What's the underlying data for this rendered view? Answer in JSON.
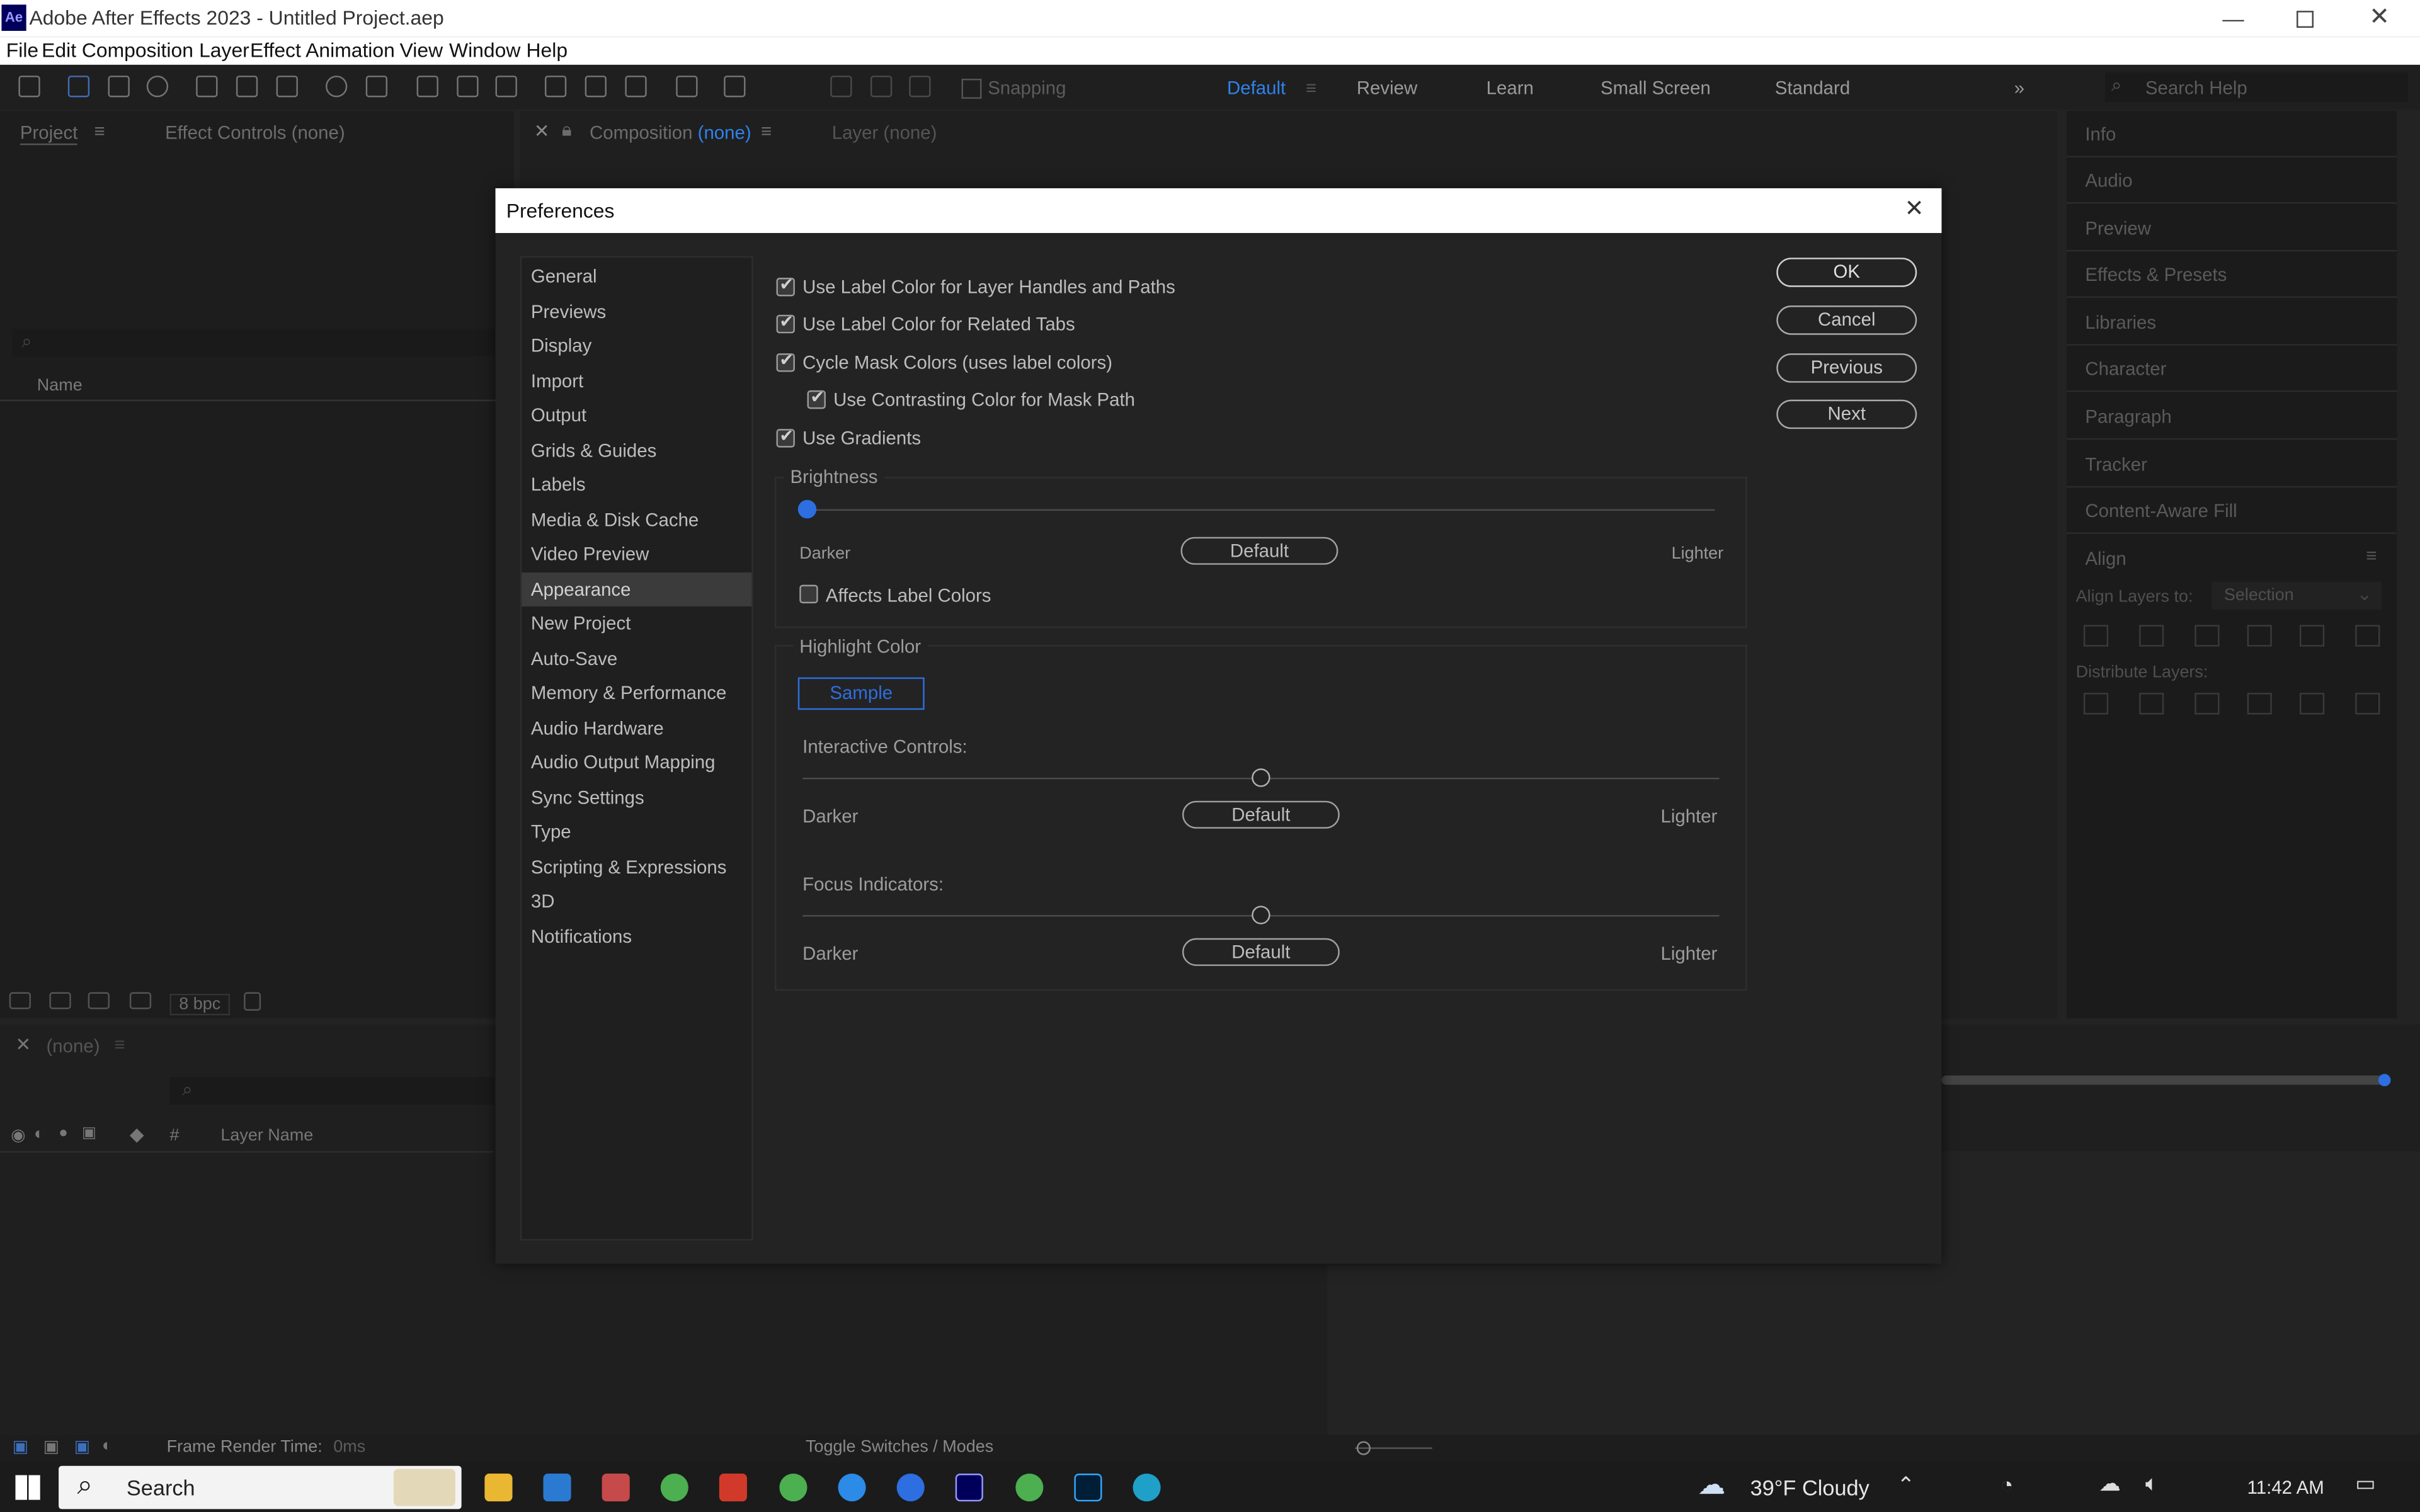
{
  "window": {
    "app_icon": "Ae",
    "title": "Adobe After Effects 2023 - Untitled Project.aep",
    "controls": [
      "minimize-icon",
      "restore-icon",
      "close-icon"
    ]
  },
  "menu": [
    "File",
    "Edit",
    "Composition",
    "Layer",
    "Effect",
    "Animation",
    "View",
    "Window",
    "Help"
  ],
  "toolbar": {
    "snapping_label": "Snapping",
    "workspaces": [
      "Default",
      "Review",
      "Learn",
      "Small Screen",
      "Standard"
    ],
    "active_workspace": "Default",
    "search_placeholder": "Search Help"
  },
  "project_panel": {
    "tab_project": "Project",
    "tab_effect_controls": "Effect Controls (none)",
    "column_name": "Name",
    "bpc": "8 bpc"
  },
  "comp_panel": {
    "tab_composition": "Composition",
    "tab_composition_value": "(none)",
    "tab_layer": "Layer (none)"
  },
  "right_panels": {
    "items": [
      "Info",
      "Audio",
      "Preview",
      "Effects & Presets",
      "Libraries",
      "Character",
      "Paragraph",
      "Tracker",
      "Content-Aware Fill"
    ],
    "align_title": "Align",
    "align_layers_to": "Align Layers to:",
    "align_select": "Selection",
    "distribute_layers": "Distribute Layers:"
  },
  "timeline": {
    "tab_label": "(none)",
    "column_hash": "#",
    "column_layer_name": "Layer Name",
    "frame_render_label": "Frame Render Time:",
    "frame_render_value": "0ms",
    "toggle_label": "Toggle Switches / Modes"
  },
  "preferences": {
    "title": "Preferences",
    "nav": [
      "General",
      "Previews",
      "Display",
      "Import",
      "Output",
      "Grids & Guides",
      "Labels",
      "Media & Disk Cache",
      "Video Preview",
      "Appearance",
      "New Project",
      "Auto-Save",
      "Memory & Performance",
      "Audio Hardware",
      "Audio Output Mapping",
      "Sync Settings",
      "Type",
      "Scripting & Expressions",
      "3D",
      "Notifications"
    ],
    "selected_nav": "Appearance",
    "checkboxes": {
      "label_color_handles": {
        "label": "Use Label Color for Layer Handles and Paths",
        "checked": true
      },
      "label_color_tabs": {
        "label": "Use Label Color for Related Tabs",
        "checked": true
      },
      "cycle_mask": {
        "label": "Cycle Mask Colors (uses label colors)",
        "checked": true
      },
      "contrasting_mask": {
        "label": "Use Contrasting Color for Mask Path",
        "checked": true
      },
      "use_gradients": {
        "label": "Use Gradients",
        "checked": true
      },
      "affects_label": {
        "label": "Affects Label Colors",
        "checked": false
      }
    },
    "brightness": {
      "title": "Brightness",
      "darker": "Darker",
      "lighter": "Lighter",
      "default_label": "Default",
      "value": 0.0
    },
    "highlight": {
      "title": "Highlight Color",
      "sample_label": "Sample",
      "interactive_label": "Interactive Controls:",
      "interactive_value": 0.5,
      "focus_label": "Focus Indicators:",
      "focus_value": 0.5,
      "darker": "Darker",
      "lighter": "Lighter",
      "default_label": "Default"
    },
    "buttons": {
      "ok": "OK",
      "cancel": "Cancel",
      "previous": "Previous",
      "next": "Next"
    },
    "accent_color": "#2d6ee0"
  },
  "taskbar": {
    "search_label": "Search",
    "weather": "39°F  Cloudy",
    "time": "11:42 AM",
    "apps": [
      "file-explorer-icon",
      "mail-icon",
      "pinned-app-icon",
      "chrome-icon",
      "wps-icon",
      "chrome-icon",
      "safari-icon",
      "zoom-icon",
      "after-effects-icon",
      "chrome-icon",
      "photoshop-icon",
      "edge-icon"
    ]
  }
}
